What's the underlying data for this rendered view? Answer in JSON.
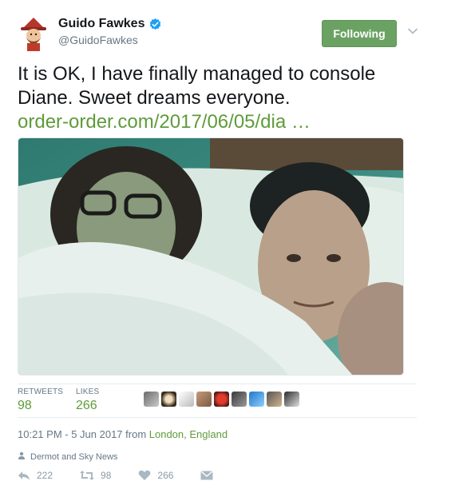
{
  "author": {
    "name": "Guido Fawkes",
    "handle": "@GuidoFawkes",
    "verified": true
  },
  "follow_button": {
    "label": "Following",
    "color": "#6ba263"
  },
  "tweet": {
    "text_line1": "It is OK, I have finally managed to console",
    "text_line2": "Diane. Sweet dreams everyone.",
    "link": "order-order.com/2017/06/05/dia …"
  },
  "stats": {
    "retweets_label": "RETWEETS",
    "retweets_value": "98",
    "likes_label": "LIKES",
    "likes_value": "266"
  },
  "timestamp": {
    "time_date": "10:21 PM - 5 Jun 2017 from ",
    "location": "London, England"
  },
  "context": {
    "text": "Dermot and Sky News",
    "icon": "person-icon"
  },
  "actions": {
    "reply_count": "222",
    "retweet_count": "98",
    "like_count": "266"
  },
  "colors": {
    "accent_green": "#5f9b3a",
    "muted": "#657786",
    "verified_blue": "#1da1f2"
  }
}
